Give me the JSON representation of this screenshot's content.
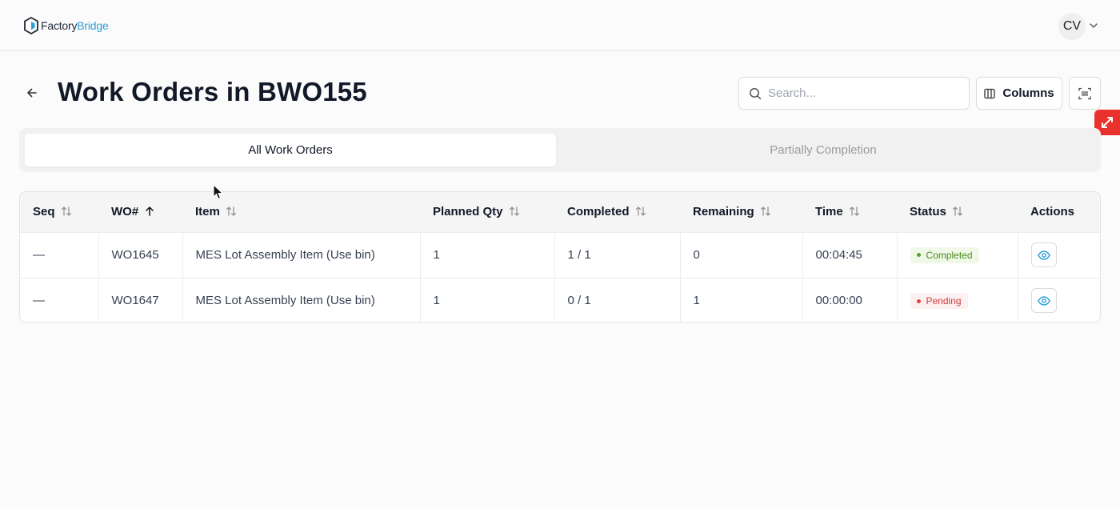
{
  "app": {
    "logo_part1": "Factory",
    "logo_part2": "Bridge",
    "brand_color": "#2a9fd6",
    "user_initials": "CV"
  },
  "header": {
    "title": "Work Orders in BWO155",
    "search_placeholder": "Search...",
    "columns_label": "Columns"
  },
  "tabs": [
    {
      "label": "All Work Orders",
      "active": true
    },
    {
      "label": "Partially Completion",
      "active": false
    }
  ],
  "table": {
    "columns": [
      "Seq",
      "WO#",
      "Item",
      "Planned Qty",
      "Completed",
      "Remaining",
      "Time",
      "Status",
      "Actions"
    ],
    "rows": [
      {
        "seq": "—",
        "wo": "WO1645",
        "item": "MES Lot Assembly Item (Use bin)",
        "planned_qty": "1",
        "completed": "1 / 1",
        "remaining": "0",
        "time": "00:04:45",
        "status": "Completed"
      },
      {
        "seq": "—",
        "wo": "WO1647",
        "item": "MES Lot Assembly Item (Use bin)",
        "planned_qty": "1",
        "completed": "0 / 1",
        "remaining": "1",
        "time": "00:00:00",
        "status": "Pending"
      }
    ]
  },
  "colors": {
    "completed": "#4a8a1c",
    "pending": "#d13a3a",
    "view_icon": "#2a9fd6",
    "float_tab": "#e8322b"
  }
}
